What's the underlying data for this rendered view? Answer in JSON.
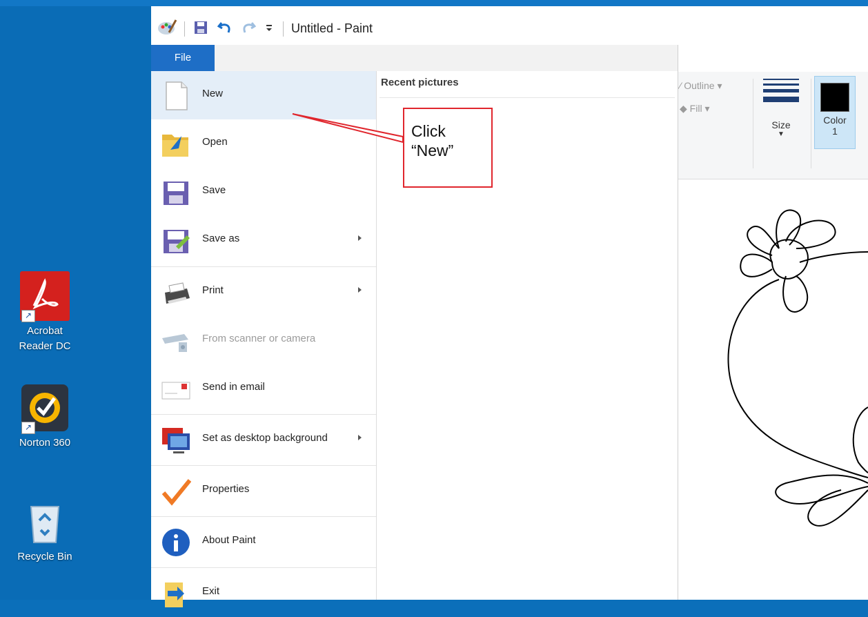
{
  "window": {
    "title": "Untitled - Paint"
  },
  "file_tab": "File",
  "menu": [
    {
      "label": "New",
      "icon": "new-page-icon",
      "submenu": false,
      "dim": false
    },
    {
      "label": "Open",
      "icon": "open-folder-icon",
      "submenu": false,
      "dim": false
    },
    {
      "label": "Save",
      "icon": "save-disk-icon",
      "submenu": false,
      "dim": false
    },
    {
      "label": "Save as",
      "icon": "save-as-icon",
      "submenu": true,
      "dim": false
    },
    {
      "label": "Print",
      "icon": "printer-icon",
      "submenu": true,
      "dim": false
    },
    {
      "label": "From scanner or camera",
      "icon": "scanner-icon",
      "submenu": false,
      "dim": true
    },
    {
      "label": "Send in email",
      "icon": "email-icon",
      "submenu": false,
      "dim": false
    },
    {
      "label": "Set as desktop background",
      "icon": "desktop-background-icon",
      "submenu": true,
      "dim": false
    },
    {
      "label": "Properties",
      "icon": "checkmark-icon",
      "submenu": false,
      "dim": false
    },
    {
      "label": "About Paint",
      "icon": "info-icon",
      "submenu": false,
      "dim": false
    },
    {
      "label": "Exit",
      "icon": "exit-icon",
      "submenu": false,
      "dim": false
    }
  ],
  "recent": {
    "heading": "Recent pictures"
  },
  "ribbon": {
    "outline": "Outline",
    "fill": "Fill",
    "size": "Size",
    "color_line1": "Color",
    "color_line2": "1",
    "color1_value": "#000000"
  },
  "callout": {
    "text": "Click\n“New”"
  },
  "desktop_icons": [
    {
      "label": "Acrobat\nReader DC",
      "icon": "acrobat-reader-icon"
    },
    {
      "label": "Norton 360",
      "icon": "norton-360-icon"
    },
    {
      "label": "Recycle Bin",
      "icon": "recycle-bin-icon"
    }
  ],
  "colors": {
    "desktop": "#0a6cb6",
    "file_tab": "#1e6ec6",
    "callout_border": "#e0262d",
    "selected_item": "#e4eef8"
  }
}
